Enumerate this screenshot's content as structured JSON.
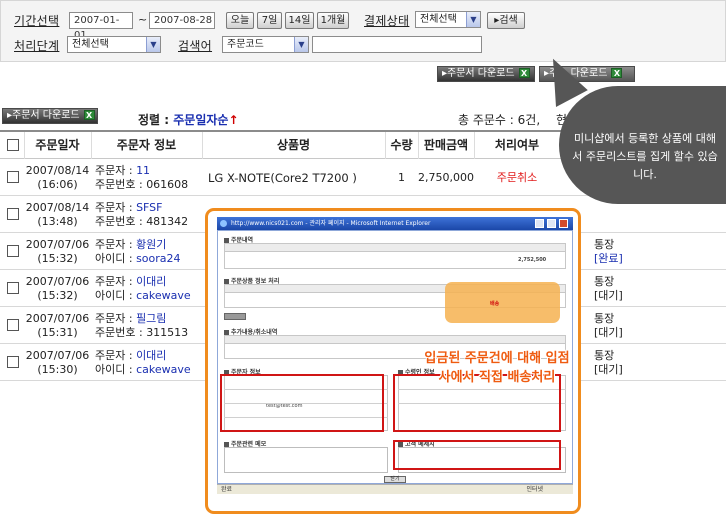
{
  "filter": {
    "period_label": "기간선택",
    "date_from": "2007-01-01",
    "date_separator": "~",
    "date_to": "2007-08-28",
    "quick_buttons": [
      "오늘",
      "7일",
      "14일",
      "1개월"
    ],
    "payment_label": "결제상태",
    "payment_value": "전체선택",
    "search_button": "검색",
    "process_label": "처리단계",
    "process_value": "전체선택",
    "search_label": "검색어",
    "search_field_value": "주문코드",
    "search_text": ""
  },
  "downloads": {
    "order_download": "주문서 다운로드",
    "address_download": "주소 다운로드",
    "list_order_download": "주문서 다운로드",
    "excel_icon_char": "X"
  },
  "list": {
    "sort_label": "정렬 :",
    "sort_value": "주문일자순",
    "sort_arrow": "↑",
    "total_label": "총 주문수 : 6건,",
    "extra_label": "현",
    "headers": [
      "주문일자",
      "주문자 정보",
      "상품명",
      "수량",
      "판매금액",
      "처리여부"
    ],
    "rows": [
      {
        "date": "2007/08/14",
        "time": "(16:06)",
        "line1_label": "주문자 : ",
        "line1_value": "11",
        "line2_label": "주문번호 : ",
        "line2_value": "061608",
        "product": "LG X-NOTE(Core2 T7200 )",
        "qty": "1",
        "price": "2,750,000",
        "status": "주문취소",
        "status_color": "#e11b1b"
      },
      {
        "date": "2007/08/14",
        "time": "(13:48)",
        "line1_label": "주문자 : ",
        "line1_value": "SFSF",
        "line2_label": "주문번호 : ",
        "line2_value": "481342",
        "product": "",
        "qty": "",
        "price": "",
        "status": "",
        "status_color": "#222222"
      },
      {
        "date": "2007/07/06",
        "time": "(15:32)",
        "line1_label": "주문자 : ",
        "line1_value": "황원기",
        "line2_label": "아이디 : ",
        "line2_value": "soora24",
        "product": "",
        "qty": "",
        "price": "",
        "status": "통장",
        "status2": "[완료]",
        "status_color": "#222222"
      },
      {
        "date": "2007/07/06",
        "time": "(15:32)",
        "line1_label": "주문자 : ",
        "line1_value": "이대리",
        "line2_label": "아이디 : ",
        "line2_value": "cakewave",
        "product": "",
        "qty": "",
        "price": "",
        "status": "통장",
        "status2": "[대기]",
        "status_color": "#222222"
      },
      {
        "date": "2007/07/06",
        "time": "(15:31)",
        "line1_label": "주문자 : ",
        "line1_value": "필그림",
        "line2_label": "주문번호 : ",
        "line2_value": "311513",
        "product": "",
        "qty": "",
        "price": "",
        "status": "통장",
        "status2": "[대기]",
        "status_color": "#222222"
      },
      {
        "date": "2007/07/06",
        "time": "(15:30)",
        "line1_label": "주문자 : ",
        "line1_value": "이대리",
        "line2_label": "아이디 : ",
        "line2_value": "cakewave",
        "product": "",
        "qty": "",
        "price": "",
        "status": "통장",
        "status2": "[대기]",
        "status_color": "#222222"
      }
    ]
  },
  "callout": {
    "text": "미니샵에서 등록한 상품에 대해서 주문리스트를 집게 할수 있습니다."
  },
  "inset": {
    "window_title": "http://www.nics021.com - 관리자 페이지 - Microsoft Internet Explorer",
    "section_order": "주문내역",
    "section_process": "주문상품 정보 처리",
    "section_history": "추가내용/취소내역",
    "section_buyer": "주문자 정보",
    "section_receiver": "수령인 정보",
    "section_memo": "주문관련 메모",
    "section_customer_memo": "고객 메세지",
    "order_amount": "2,752,500",
    "status_red": "배송",
    "email": "test@test.com",
    "overlay_text": "입금된 주문건에 대해 입점사에서 직접 배송처리",
    "status_bar_left": "완료",
    "status_bar_right": "인터넷",
    "close_button": "닫기"
  },
  "colors": {
    "accent_blue": "#1a2fb0",
    "accent_red": "#e11b1b",
    "callout_bg": "#565656",
    "inset_border": "#f08c1e",
    "overlay_text": "#ef5b10"
  }
}
